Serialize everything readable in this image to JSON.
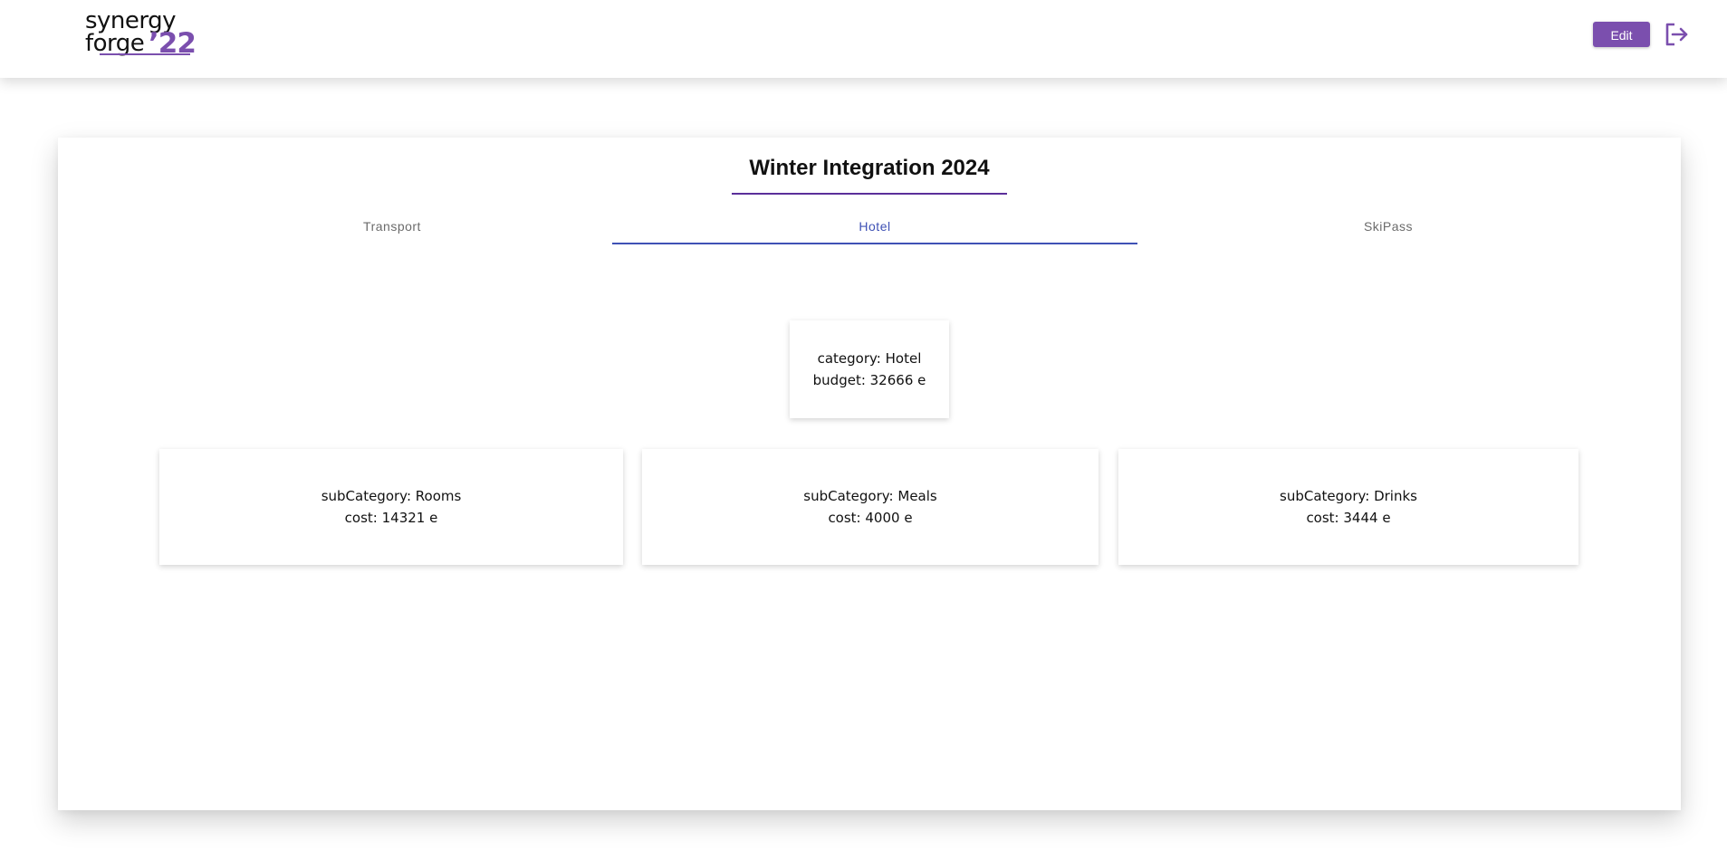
{
  "header": {
    "logo_line1": "synergy",
    "logo_line2": "forge",
    "logo_year": "’22",
    "edit_label": "Edit",
    "logout_icon": "logout-icon"
  },
  "colors": {
    "accent": "#7b4fae",
    "tab_active": "#3f51b5",
    "title_underline": "#5b2f9a"
  },
  "main": {
    "title": "Winter Integration 2024",
    "tabs": [
      {
        "label": "Transport",
        "active": false
      },
      {
        "label": "Hotel",
        "active": true
      },
      {
        "label": "SkiPass",
        "active": false
      }
    ],
    "category": {
      "category_text": "category: Hotel",
      "budget_text": "budget: 32666 e"
    },
    "subcategories": [
      {
        "subcategory_text": "subCategory: Rooms",
        "cost_text": "cost: 14321 e"
      },
      {
        "subcategory_text": "subCategory: Meals",
        "cost_text": "cost: 4000 e"
      },
      {
        "subcategory_text": "subCategory: Drinks",
        "cost_text": "cost: 3444 e"
      }
    ]
  }
}
